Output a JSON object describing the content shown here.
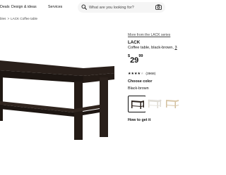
{
  "nav": {
    "items": [
      "Deals",
      "Design & ideas",
      "Services"
    ]
  },
  "search": {
    "placeholder": "What are you looking for?"
  },
  "breadcrumb": {
    "items": [
      "bles",
      "LACK Coffee table"
    ],
    "separator": ">"
  },
  "product": {
    "series_link": "More from the LACK series",
    "name": "LACK",
    "description": "Coffee table, black-brown,",
    "measurement": "3",
    "price": {
      "currency": "$",
      "whole": "29",
      "cents": "99"
    },
    "rating": {
      "stars": 4.5,
      "max": 5,
      "count": "(3968)"
    },
    "color_heading": "Choose color",
    "color_selected": "Black-brown",
    "swatches": [
      "black-brown",
      "white",
      "white stained oak effect"
    ],
    "how_to_get_it": "How to get it"
  },
  "colors": {
    "brown_dark": "#2a201b",
    "accent_text": "#111111",
    "muted_text": "#484848",
    "search_bg": "#f5f5f5"
  },
  "icons": {
    "search": "search-icon",
    "camera": "camera-icon"
  }
}
